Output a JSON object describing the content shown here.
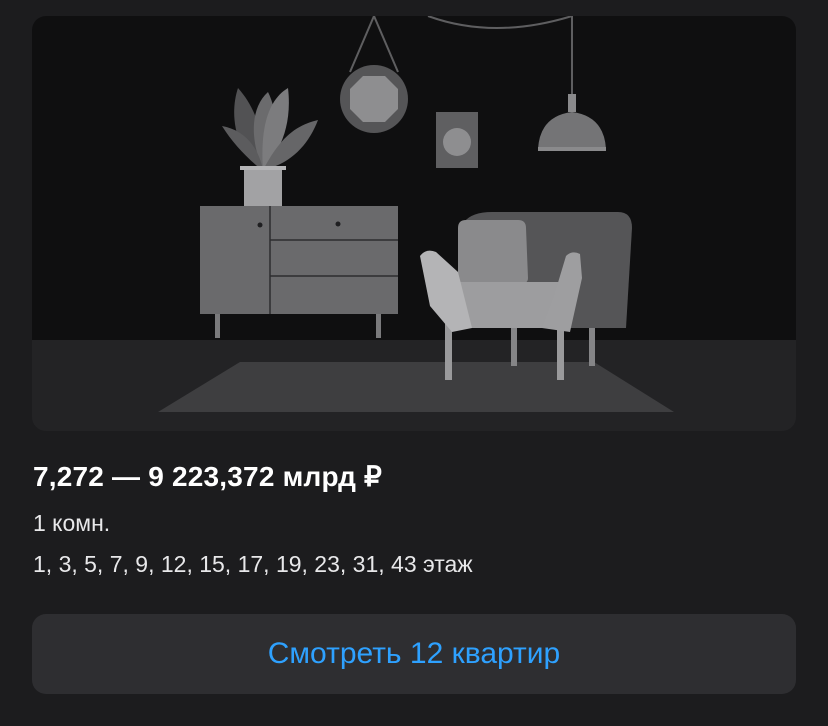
{
  "listing": {
    "price_range": "7,272 — 9 223,372 млрд ₽",
    "rooms": "1 комн.",
    "floors": "1, 3, 5, 7, 9, 12, 15, 17, 19, 23, 31, 43 этаж"
  },
  "actions": {
    "view_button_label": "Смотреть 12 квартир"
  },
  "illustration": {
    "icon": "placeholder-room-illustration"
  },
  "colors": {
    "background": "#1c1c1e",
    "button_background": "#2e2e31",
    "button_text": "#2ea1ff",
    "text_primary": "#ffffff"
  }
}
